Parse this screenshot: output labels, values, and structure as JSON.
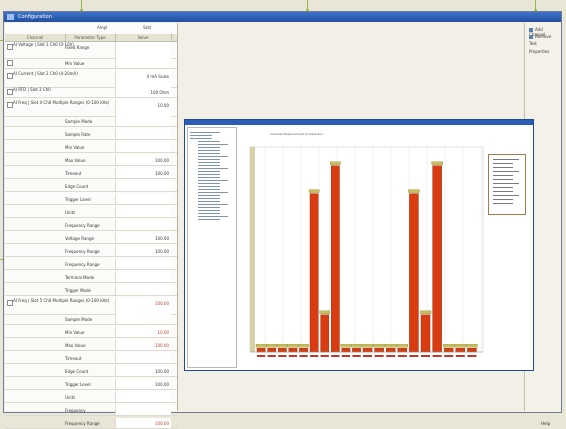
{
  "window": {
    "title": "Configuration"
  },
  "top_tools": {
    "left": "Ampl",
    "right": "Stat"
  },
  "columns": [
    "Channel",
    "Parameter Type",
    "Value"
  ],
  "rows": [
    {
      "type": "cat",
      "text": "AI Voltage | Slot 1 Ch0 (0-10V)",
      "label": "Fixed Range",
      "value": "",
      "tall": true
    },
    {
      "type": "cat",
      "text": "",
      "label": "Min Value",
      "value": ""
    },
    {
      "type": "cat",
      "text": "AI Current | Slot 2 Ch0 (4-20mA)",
      "label": "",
      "value": "4 mA Scale",
      "tall": true
    },
    {
      "type": "cat",
      "text": "AI RTD | Slot 3 Ch0",
      "label": "",
      "value": "100 Ohm"
    },
    {
      "type": "cat",
      "text": "AI Freq | Slot 4 Ch0 Multiple Ranges (0-100 kHz)",
      "label": "",
      "value": "10.00",
      "tall": true
    },
    {
      "type": "sub",
      "label": "Sample Mode",
      "value": ""
    },
    {
      "type": "sub",
      "label": "Sample Rate",
      "value": ""
    },
    {
      "type": "sub",
      "label": "Min Value",
      "value": ""
    },
    {
      "type": "sub",
      "label": "Max Value",
      "value": "100.00"
    },
    {
      "type": "sub",
      "label": "Timeout",
      "value": "100.00"
    },
    {
      "type": "sub",
      "label": "Edge Count",
      "value": ""
    },
    {
      "type": "sub",
      "label": "Trigger Level",
      "value": ""
    },
    {
      "type": "sub",
      "label": "Units",
      "value": ""
    },
    {
      "type": "sub",
      "label": "Frequency Range",
      "value": ""
    },
    {
      "type": "sub",
      "label": "Voltage Range",
      "value": "100.00"
    },
    {
      "type": "sub",
      "label": "Frequency Range",
      "value": "100.00"
    },
    {
      "type": "sub",
      "label": "Frequency Range",
      "value": ""
    },
    {
      "type": "sub",
      "label": "Terminal Mode",
      "value": ""
    },
    {
      "type": "sub",
      "label": "Trigger Mode",
      "value": ""
    },
    {
      "type": "cat",
      "text": "AI Freq | Slot 5 Ch0 Multiple Ranges (0-100 kHz)",
      "label": "",
      "value": "100.00",
      "red": true,
      "tall": true
    },
    {
      "type": "sub",
      "label": "Sample Mode",
      "value": ""
    },
    {
      "type": "sub",
      "label": "Min Value",
      "value": "10.00",
      "red": true
    },
    {
      "type": "sub",
      "label": "Max Value",
      "value": "100.00",
      "red": true
    },
    {
      "type": "sub",
      "label": "Timeout",
      "value": ""
    },
    {
      "type": "sub",
      "label": "Edge Count",
      "value": "100.00"
    },
    {
      "type": "sub",
      "label": "Trigger Level",
      "value": "100.00"
    },
    {
      "type": "sub",
      "label": "Units",
      "value": ""
    },
    {
      "type": "sub",
      "label": "Frequency",
      "value": ""
    },
    {
      "type": "sub",
      "label": "Frequency Range",
      "value": "100.00",
      "red": true
    }
  ],
  "right_toolbar": [
    {
      "label": "Add Channel",
      "icon": "add-icon"
    },
    {
      "label": "Remove",
      "icon": "remove-icon"
    },
    {
      "label": "Test",
      "icon": ""
    },
    {
      "label": "Properties",
      "icon": ""
    }
  ],
  "status": {
    "text": "Help"
  },
  "chart": {
    "title": "Channel Measurement Comparison",
    "colors": {
      "bar": "#d93c10",
      "band": "#d9cfa4",
      "label": "#c9bf5a"
    }
  },
  "chart_data": {
    "type": "bar",
    "categories": [
      "1",
      "2",
      "3",
      "4",
      "5",
      "6",
      "7",
      "8",
      "9",
      "10",
      "11",
      "12",
      "13",
      "14",
      "15",
      "16",
      "17",
      "18",
      "19",
      "20"
    ],
    "values": [
      2,
      2,
      2,
      2,
      2,
      85,
      20,
      100,
      2,
      2,
      2,
      2,
      2,
      2,
      85,
      20,
      100,
      2,
      2,
      2
    ],
    "ylim": [
      0,
      110
    ],
    "grid": true,
    "legend": "top-right"
  }
}
